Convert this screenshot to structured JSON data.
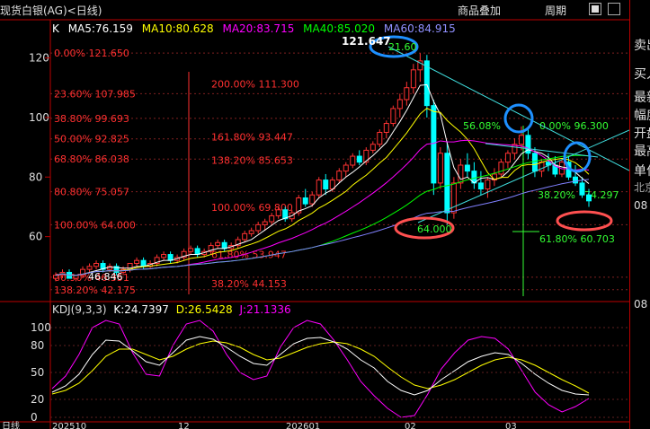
{
  "title": "现货白银(AG)<日线)",
  "toolbar": {
    "overlay_label": "商品叠加",
    "period_label": "周期"
  },
  "indicator_mode": "K",
  "ma": {
    "ma5": "MA5:76.159",
    "ma10": "MA10:80.628",
    "ma20": "MA20:83.715",
    "ma40": "MA40:85.020",
    "ma60": "MA60:84.915"
  },
  "kdj": {
    "name": "KDJ(9,3,3)",
    "k": "K:24.7397",
    "d": "D:26.5428",
    "j": "J:21.1336"
  },
  "price_axis": [
    "120",
    "100",
    "80",
    "60"
  ],
  "kdj_axis": [
    "100",
    "80",
    "50",
    "20",
    "0"
  ],
  "date_axis": [
    "日线",
    "202510",
    "12",
    "202601",
    "02",
    "03"
  ],
  "fib_left": [
    "0.00% 121.650",
    "23.60% 107.985",
    "38.80% 99.693",
    "50.00% 92.825",
    "68.80% 86.038",
    "80.80% 75.057",
    "100.00% 64.000",
    "80.90% 46.351",
    "138.20% 42.175"
  ],
  "fib_center": [
    "200.00%   111.300",
    "161.80%   93.447",
    "138.20%   85.653",
    "100.00%   69.800",
    "61.80%   53.947",
    "38.20%   44.153"
  ],
  "fib_right": [
    "56.08%",
    "0.00%   96.300",
    "38.20%",
    "74.297",
    "61.80%   60.703"
  ],
  "annotations": {
    "peak": "121.647",
    "peak_circle": "21.60",
    "low": "64.000",
    "recent_low": "46.846"
  },
  "sidebar": [
    "卖出",
    "买入",
    "最新",
    "幅度",
    "开盘",
    "最高",
    "单位",
    "北京",
    "08",
    "08"
  ],
  "colors": {
    "ma5": "#ffffff",
    "ma10": "#ffff00",
    "ma20": "#ff00ff",
    "ma40": "#00ff00",
    "ma60": "#8080ff",
    "up": "#ff3232",
    "down": "#00ffff",
    "fib": "#ff3030",
    "fib_green": "#33ff33",
    "circle_blue": "#1e90ff",
    "circle_red": "#ff5050"
  },
  "chart_data": {
    "type": "candlestick",
    "y_range": [
      40,
      128
    ],
    "kdj_range": [
      0,
      110
    ],
    "candles": [
      [
        46,
        48,
        45,
        47
      ],
      [
        47,
        49,
        46,
        48
      ],
      [
        48,
        49,
        46,
        46
      ],
      [
        46,
        47,
        45,
        47
      ],
      [
        47,
        50,
        46,
        49
      ],
      [
        49,
        51,
        48,
        50
      ],
      [
        50,
        52,
        49,
        51
      ],
      [
        51,
        52,
        48,
        49
      ],
      [
        49,
        51,
        48,
        50
      ],
      [
        50,
        51,
        47,
        48
      ],
      [
        48,
        50,
        47,
        49
      ],
      [
        49,
        51,
        48,
        51
      ],
      [
        51,
        53,
        50,
        52
      ],
      [
        52,
        53,
        49,
        50
      ],
      [
        50,
        52,
        49,
        51
      ],
      [
        51,
        54,
        50,
        53
      ],
      [
        53,
        55,
        52,
        54
      ],
      [
        54,
        55,
        51,
        52
      ],
      [
        52,
        54,
        51,
        53
      ],
      [
        53,
        56,
        52,
        55
      ],
      [
        55,
        57,
        54,
        56
      ],
      [
        56,
        57,
        53,
        54
      ],
      [
        54,
        56,
        53,
        55
      ],
      [
        55,
        58,
        54,
        57
      ],
      [
        57,
        59,
        56,
        58
      ],
      [
        58,
        59,
        55,
        56
      ],
      [
        56,
        58,
        55,
        57
      ],
      [
        57,
        60,
        56,
        59
      ],
      [
        59,
        62,
        58,
        61
      ],
      [
        61,
        63,
        60,
        62
      ],
      [
        62,
        65,
        61,
        64
      ],
      [
        64,
        66,
        62,
        65
      ],
      [
        65,
        68,
        64,
        67
      ],
      [
        67,
        70,
        66,
        69
      ],
      [
        69,
        70,
        65,
        66
      ],
      [
        66,
        69,
        65,
        68
      ],
      [
        68,
        74,
        67,
        73
      ],
      [
        73,
        76,
        70,
        71
      ],
      [
        71,
        75,
        70,
        74
      ],
      [
        74,
        80,
        73,
        79
      ],
      [
        79,
        81,
        74,
        76
      ],
      [
        76,
        80,
        75,
        79
      ],
      [
        79,
        83,
        78,
        82
      ],
      [
        82,
        85,
        80,
        84
      ],
      [
        84,
        88,
        83,
        87
      ],
      [
        87,
        89,
        84,
        85
      ],
      [
        85,
        90,
        84,
        89
      ],
      [
        89,
        92,
        88,
        91
      ],
      [
        91,
        96,
        90,
        95
      ],
      [
        95,
        99,
        93,
        98
      ],
      [
        98,
        104,
        97,
        103
      ],
      [
        103,
        108,
        100,
        106
      ],
      [
        106,
        112,
        104,
        110
      ],
      [
        110,
        118,
        108,
        116
      ],
      [
        116,
        121.6,
        112,
        119
      ],
      [
        119,
        121,
        100,
        104
      ],
      [
        104,
        106,
        74,
        78
      ],
      [
        78,
        90,
        76,
        88
      ],
      [
        88,
        92,
        64,
        68
      ],
      [
        68,
        80,
        66,
        78
      ],
      [
        78,
        86,
        76,
        84
      ],
      [
        84,
        88,
        80,
        82
      ],
      [
        82,
        85,
        76,
        78
      ],
      [
        78,
        82,
        74,
        76
      ],
      [
        76,
        80,
        73,
        79
      ],
      [
        79,
        83,
        77,
        81
      ],
      [
        81,
        86,
        80,
        85
      ],
      [
        85,
        89,
        83,
        88
      ],
      [
        88,
        93,
        86,
        91
      ],
      [
        91,
        97,
        89,
        94
      ],
      [
        94,
        97,
        86,
        88
      ],
      [
        88,
        90,
        80,
        82
      ],
      [
        82,
        86,
        80,
        85
      ],
      [
        85,
        88,
        82,
        84
      ],
      [
        84,
        87,
        80,
        81
      ],
      [
        81,
        86,
        80,
        85
      ],
      [
        85,
        87,
        79,
        80
      ],
      [
        80,
        84,
        77,
        78
      ],
      [
        78,
        80,
        73,
        74
      ],
      [
        74,
        76,
        70,
        72
      ]
    ],
    "kdj_values": {
      "k": [
        28,
        35,
        48,
        70,
        86,
        85,
        74,
        62,
        58,
        72,
        86,
        90,
        87,
        78,
        68,
        60,
        58,
        70,
        82,
        88,
        89,
        84,
        76,
        64,
        55,
        40,
        30,
        25,
        30,
        42,
        52,
        62,
        68,
        72,
        70,
        60,
        48,
        38,
        30,
        26,
        25
      ],
      "d": [
        26,
        30,
        38,
        52,
        68,
        76,
        76,
        70,
        64,
        68,
        76,
        82,
        85,
        83,
        78,
        70,
        64,
        66,
        72,
        78,
        82,
        84,
        82,
        76,
        68,
        56,
        45,
        36,
        32,
        36,
        42,
        50,
        58,
        64,
        67,
        64,
        58,
        50,
        42,
        35,
        27
      ],
      "j": [
        32,
        46,
        70,
        100,
        108,
        104,
        72,
        48,
        46,
        80,
        104,
        108,
        96,
        70,
        50,
        42,
        46,
        78,
        100,
        108,
        104,
        86,
        64,
        40,
        24,
        10,
        0,
        2,
        26,
        54,
        72,
        86,
        90,
        88,
        76,
        52,
        28,
        14,
        6,
        12,
        21
      ]
    }
  }
}
